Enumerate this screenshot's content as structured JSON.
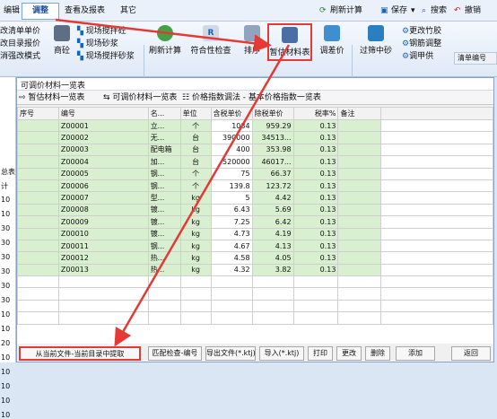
{
  "menubar": {
    "left_label": "编辑",
    "active_tab": "调整",
    "tab_report": "查看及报表",
    "tab_other": "其它",
    "refresh": "刷新计算",
    "save": "保存",
    "search": "搜索",
    "undo": "撤销"
  },
  "ribbon": {
    "left_items": [
      "改清单单价",
      "改目录报价",
      "消强改模式"
    ],
    "shangshuan": "商砼",
    "xianchang": [
      "现场搅拌砼",
      "现场砂浆",
      "现场搅拌砂浆"
    ],
    "refresh": "刷新计算",
    "check": "符合性检查",
    "order": "排序",
    "materials": "暂估材料表",
    "adj_price": "调差价",
    "filter_sand": "过筛中砂",
    "right_items": [
      "更改竹胶",
      "钢筋调整",
      "调甲供"
    ],
    "far_right": "清单编号"
  },
  "window": {
    "title": "可调价材料一览表",
    "tabs": [
      "暂估材料一览表",
      "可调价材料一览表",
      "价格指数调法 - 基本价格指数一览表"
    ]
  },
  "table": {
    "headers": [
      "序号",
      "编号",
      "名...",
      "单位",
      "含税单价",
      "除税单价",
      "税率%",
      "备注"
    ],
    "rows": [
      [
        "",
        "Z00001",
        "立...",
        "个",
        "1084",
        "959.29",
        "0.13",
        ""
      ],
      [
        "",
        "Z00002",
        "无...",
        "台",
        "390000",
        "34513...",
        "0.13",
        ""
      ],
      [
        "",
        "Z00003",
        "配电箱",
        "台",
        "400",
        "353.98",
        "0.13",
        ""
      ],
      [
        "",
        "Z00004",
        "加...",
        "台",
        "520000",
        "46017...",
        "0.13",
        ""
      ],
      [
        "",
        "Z00005",
        "钢...",
        "个",
        "75",
        "66.37",
        "0.13",
        ""
      ],
      [
        "",
        "Z00006",
        "钢...",
        "个",
        "139.8",
        "123.72",
        "0.13",
        ""
      ],
      [
        "",
        "Z00007",
        "型...",
        "kg",
        "5",
        "4.42",
        "0.13",
        ""
      ],
      [
        "",
        "Z00008",
        "镀...",
        "kg",
        "6.43",
        "5.69",
        "0.13",
        ""
      ],
      [
        "",
        "Z00009",
        "镀...",
        "kg",
        "7.25",
        "6.42",
        "0.13",
        ""
      ],
      [
        "",
        "Z00010",
        "镀...",
        "kg",
        "4.73",
        "4.19",
        "0.13",
        ""
      ],
      [
        "",
        "Z00011",
        "钢...",
        "kg",
        "4.67",
        "4.13",
        "0.13",
        ""
      ],
      [
        "",
        "Z00012",
        "热...",
        "kg",
        "4.58",
        "4.05",
        "0.13",
        ""
      ],
      [
        "",
        "Z00013",
        "热...",
        "kg",
        "4.32",
        "3.82",
        "0.13",
        ""
      ]
    ]
  },
  "left_panel": [
    "总表",
    "计",
    "10",
    "10",
    "30",
    "30",
    "30",
    "30",
    "30",
    "30",
    "10",
    "10",
    "20",
    "10",
    "10",
    "10",
    "10",
    "10"
  ],
  "bottom": {
    "extract": "从当前文件-当前目录中提取",
    "match": "匹配检查-编号",
    "export": "导出文件(*.ktj)",
    "import": "导入(*.ktj)",
    "print": "打印",
    "change": "更改",
    "delete": "删除",
    "add": "添加",
    "back": "返回"
  },
  "colors": {
    "highlight": "#e53935",
    "green_cell": "#d9f0d0",
    "ribbon_bg": "#eaf1fb"
  }
}
